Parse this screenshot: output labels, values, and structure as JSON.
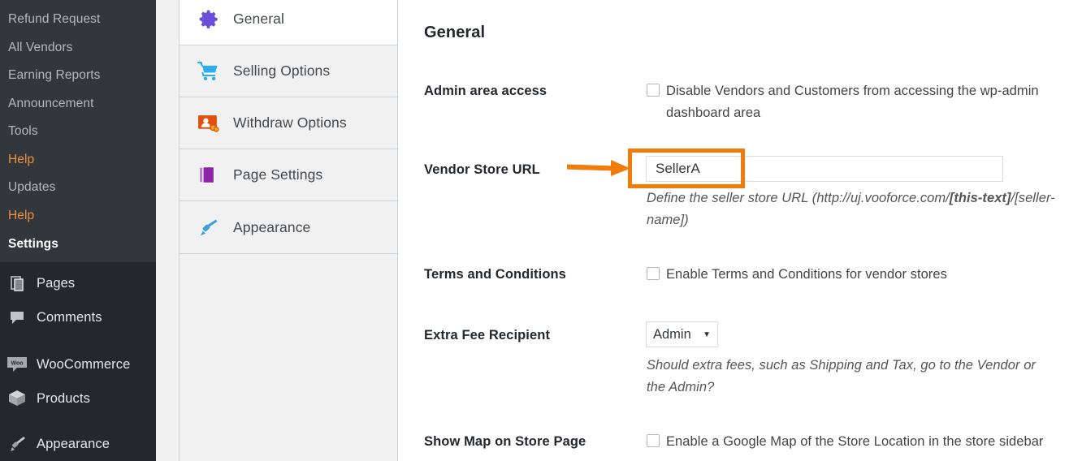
{
  "wp_sidebar": {
    "submenu_items": [
      {
        "label": "Refund Request",
        "state": "normal"
      },
      {
        "label": "All Vendors",
        "state": "normal"
      },
      {
        "label": "Earning Reports",
        "state": "normal"
      },
      {
        "label": "Announcement",
        "state": "normal"
      },
      {
        "label": "Tools",
        "state": "normal"
      },
      {
        "label": "Help",
        "state": "help"
      },
      {
        "label": "Updates",
        "state": "normal"
      },
      {
        "label": "Help",
        "state": "help"
      },
      {
        "label": "Settings",
        "state": "active"
      }
    ],
    "menu_items": [
      {
        "label": "Pages",
        "icon": "pages-icon"
      },
      {
        "label": "Comments",
        "icon": "comments-icon"
      },
      {
        "label": "WooCommerce",
        "icon": "woocommerce-icon",
        "badge_text": "Woo"
      },
      {
        "label": "Products",
        "icon": "products-box-icon"
      },
      {
        "label": "Appearance",
        "icon": "appearance-brush-icon"
      }
    ]
  },
  "settings_nav": {
    "items": [
      {
        "label": "General",
        "icon": "gear-icon",
        "active": true
      },
      {
        "label": "Selling Options",
        "icon": "shopping-cart-icon",
        "active": false
      },
      {
        "label": "Withdraw Options",
        "icon": "withdraw-user-icon",
        "active": false
      },
      {
        "label": "Page Settings",
        "icon": "pages-stack-icon",
        "active": false
      },
      {
        "label": "Appearance",
        "icon": "paint-brush-icon",
        "active": false
      }
    ]
  },
  "main": {
    "title": "General",
    "fields": {
      "admin_area_access": {
        "label": "Admin area access",
        "checkbox_label": "Disable Vendors and Customers from accessing the wp-admin dashboard area",
        "checked": false
      },
      "vendor_store_url": {
        "label": "Vendor Store URL",
        "value": "SellerA",
        "placeholder": "",
        "description_prefix": "Define the seller store URL (http://uj.vooforce.com/",
        "description_bold": "[this-text]",
        "description_suffix": "/[seller-name])"
      },
      "terms_and_conditions": {
        "label": "Terms and Conditions",
        "checkbox_label": "Enable Terms and Conditions for vendor stores",
        "checked": false
      },
      "extra_fee_recipient": {
        "label": "Extra Fee Recipient",
        "selected": "Admin",
        "caret": "▼",
        "description": "Should extra fees, such as Shipping and Tax, go to the Vendor or the Admin?"
      },
      "show_map_on_store_page": {
        "label": "Show Map on Store Page",
        "checkbox_label": "Enable a Google Map of the Store Location in the store sidebar",
        "checked": false
      }
    }
  },
  "annotations": {
    "highlight_color": "#f07c0b",
    "arrow_color": "#f07c0b",
    "arrow_target": "vendor-store-url-input"
  },
  "colors": {
    "sidebar_bg": "#23282d",
    "submenu_bg": "#32373c",
    "nav_panel_bg": "#f1f1f1",
    "accent_orange": "#f0913a",
    "gear_purple": "#6c4fd8",
    "cart_blue": "#2eadeb",
    "withdraw_orange": "#e2500d",
    "pages_purple": "#9b27b0",
    "brush_blue": "#3d9fdd"
  }
}
